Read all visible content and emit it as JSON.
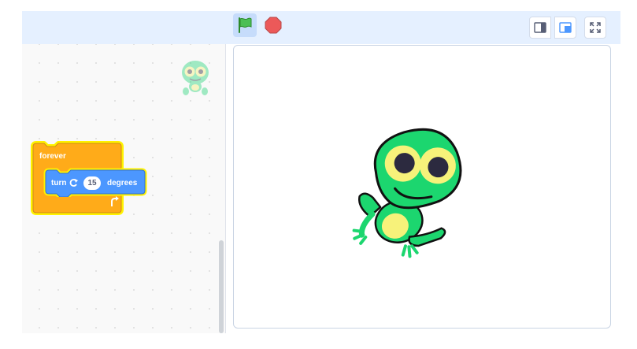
{
  "header": {
    "green_flag": "green-flag-icon",
    "stop": "stop-icon",
    "small_stage_mode": "small-stage-icon",
    "normal_stage_mode": "normal-stage-icon",
    "fullscreen": "fullscreen-icon"
  },
  "code": {
    "forever_block": {
      "label": "forever"
    },
    "turn_block": {
      "label": "turn",
      "icon": "rotate-right-icon",
      "value": "15",
      "unit": "degrees"
    }
  },
  "colors": {
    "header_bg": "#e5f0ff",
    "control_block": "#ffab19",
    "motion_block": "#4c97ff",
    "glow": "#fff200",
    "sprite_green": "#1cd66f",
    "sprite_eye": "#f7f27a"
  }
}
